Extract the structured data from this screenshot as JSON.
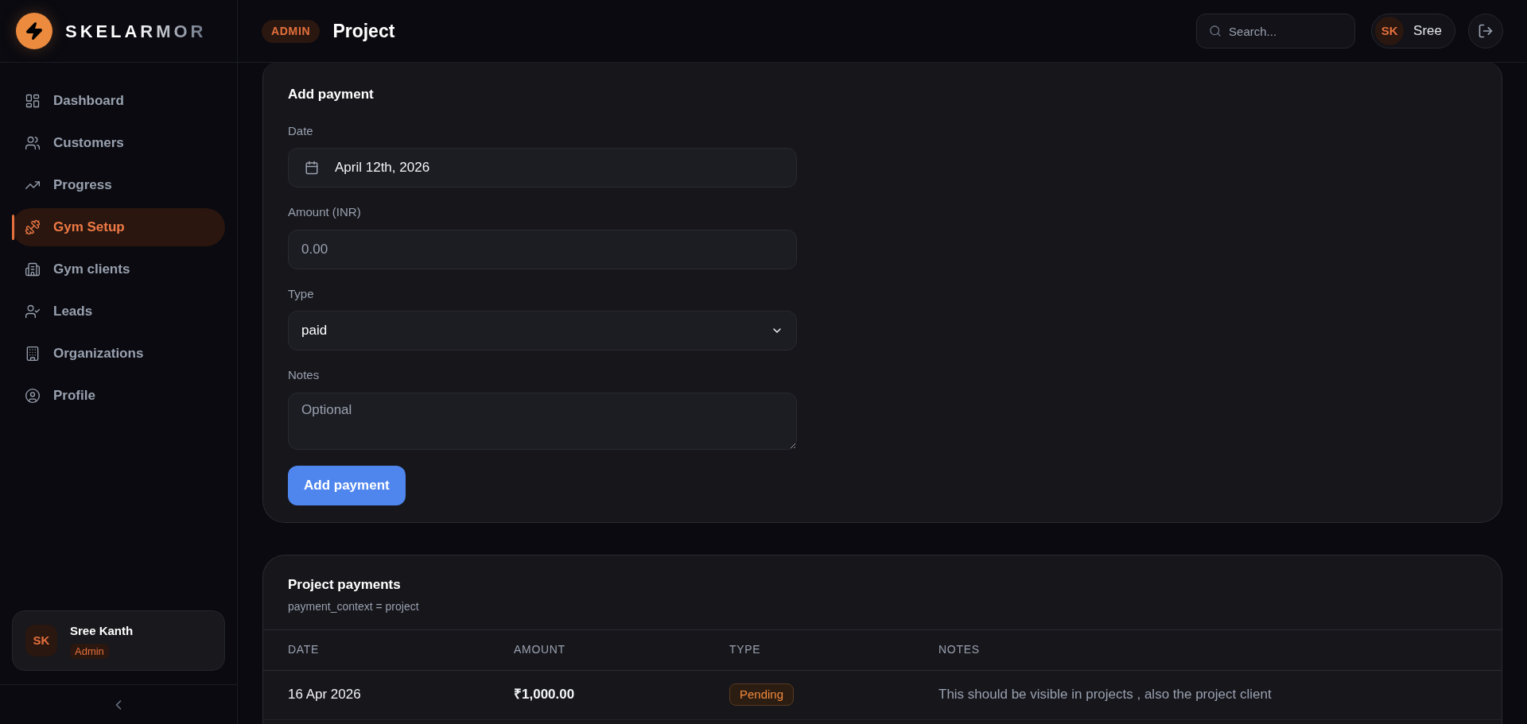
{
  "brand": {
    "name": "SKELARMOR"
  },
  "header": {
    "badge": "ADMIN",
    "title": "Project",
    "search": {
      "placeholder": "Search..."
    },
    "user": {
      "initials": "SK",
      "name": "Sree"
    }
  },
  "sidebar": {
    "items": [
      {
        "label": "Dashboard",
        "selected": false
      },
      {
        "label": "Customers",
        "selected": false
      },
      {
        "label": "Progress",
        "selected": false
      },
      {
        "label": "Gym Setup",
        "selected": true
      },
      {
        "label": "Gym clients",
        "selected": false
      },
      {
        "label": "Leads",
        "selected": false
      },
      {
        "label": "Organizations",
        "selected": false
      },
      {
        "label": "Profile",
        "selected": false
      }
    ],
    "profile": {
      "initials": "SK",
      "name": "Sree Kanth",
      "role": "Admin"
    }
  },
  "add_payment": {
    "title": "Add payment",
    "fields": [
      {
        "kind": "date",
        "label": "Date",
        "value": "April 12th, 2026"
      },
      {
        "kind": "number",
        "label": "Amount (INR)",
        "placeholder": "0.00"
      },
      {
        "kind": "select",
        "label": "Type",
        "value": "paid"
      },
      {
        "kind": "textarea",
        "label": "Notes",
        "placeholder": "Optional"
      }
    ],
    "button": "Add payment"
  },
  "payments": {
    "title": "Project payments",
    "subtitle": "payment_context = project",
    "columns": [
      "DATE",
      "AMOUNT",
      "TYPE",
      "NOTES"
    ],
    "rows": [
      {
        "date": "16 Apr 2026",
        "amount": "₹1,000.00",
        "type": "Pending",
        "notes": "This should be visible in projects , also the project client"
      }
    ]
  }
}
